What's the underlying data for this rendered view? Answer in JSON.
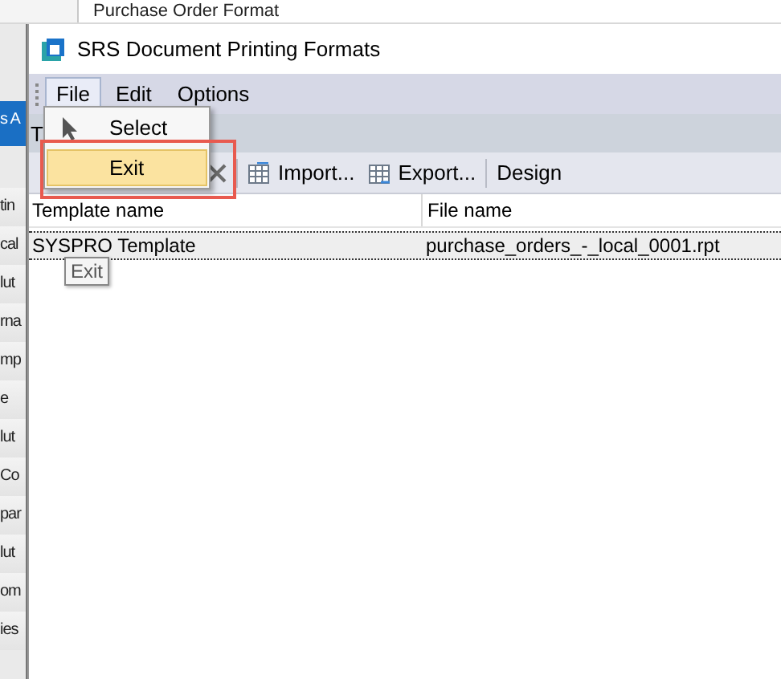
{
  "background_app": {
    "header_text": "Purchase Order Format",
    "side_items": [
      {
        "label": "s A",
        "selected": true
      },
      {
        "label": "tin",
        "selected": false
      },
      {
        "label": "cal",
        "selected": false
      },
      {
        "label": "lut",
        "selected": false
      },
      {
        "label": "rna",
        "selected": false
      },
      {
        "label": "mp",
        "selected": false
      },
      {
        "label": "e",
        "selected": false
      },
      {
        "label": "lut",
        "selected": false
      },
      {
        "label": "Co",
        "selected": false
      },
      {
        "label": "par",
        "selected": false
      },
      {
        "label": "lut",
        "selected": false
      },
      {
        "label": "om",
        "selected": false
      },
      {
        "label": "ies",
        "selected": false
      }
    ]
  },
  "window": {
    "title": "SRS Document Printing Formats"
  },
  "menu": [
    {
      "label": "File",
      "selected": true
    },
    {
      "label": "Edit",
      "selected": false
    },
    {
      "label": "Options",
      "selected": false
    }
  ],
  "file_menu": [
    {
      "kind": "pointer",
      "label": "Select",
      "selected": false
    },
    {
      "kind": "plain",
      "label": "Exit",
      "selected": true
    }
  ],
  "band_label": "T",
  "toolbar": [
    {
      "kind": "delete"
    },
    {
      "kind": "import",
      "label": "Import..."
    },
    {
      "kind": "export",
      "label": "Export..."
    },
    {
      "kind": "design",
      "label": "Design"
    }
  ],
  "table": {
    "columns": [
      "Template name",
      "File name"
    ],
    "rows": [
      {
        "cells": [
          "SYSPRO Template",
          "purchase_orders_-_local_0001.rpt"
        ],
        "selected": true
      }
    ]
  },
  "tooltip": "Exit"
}
